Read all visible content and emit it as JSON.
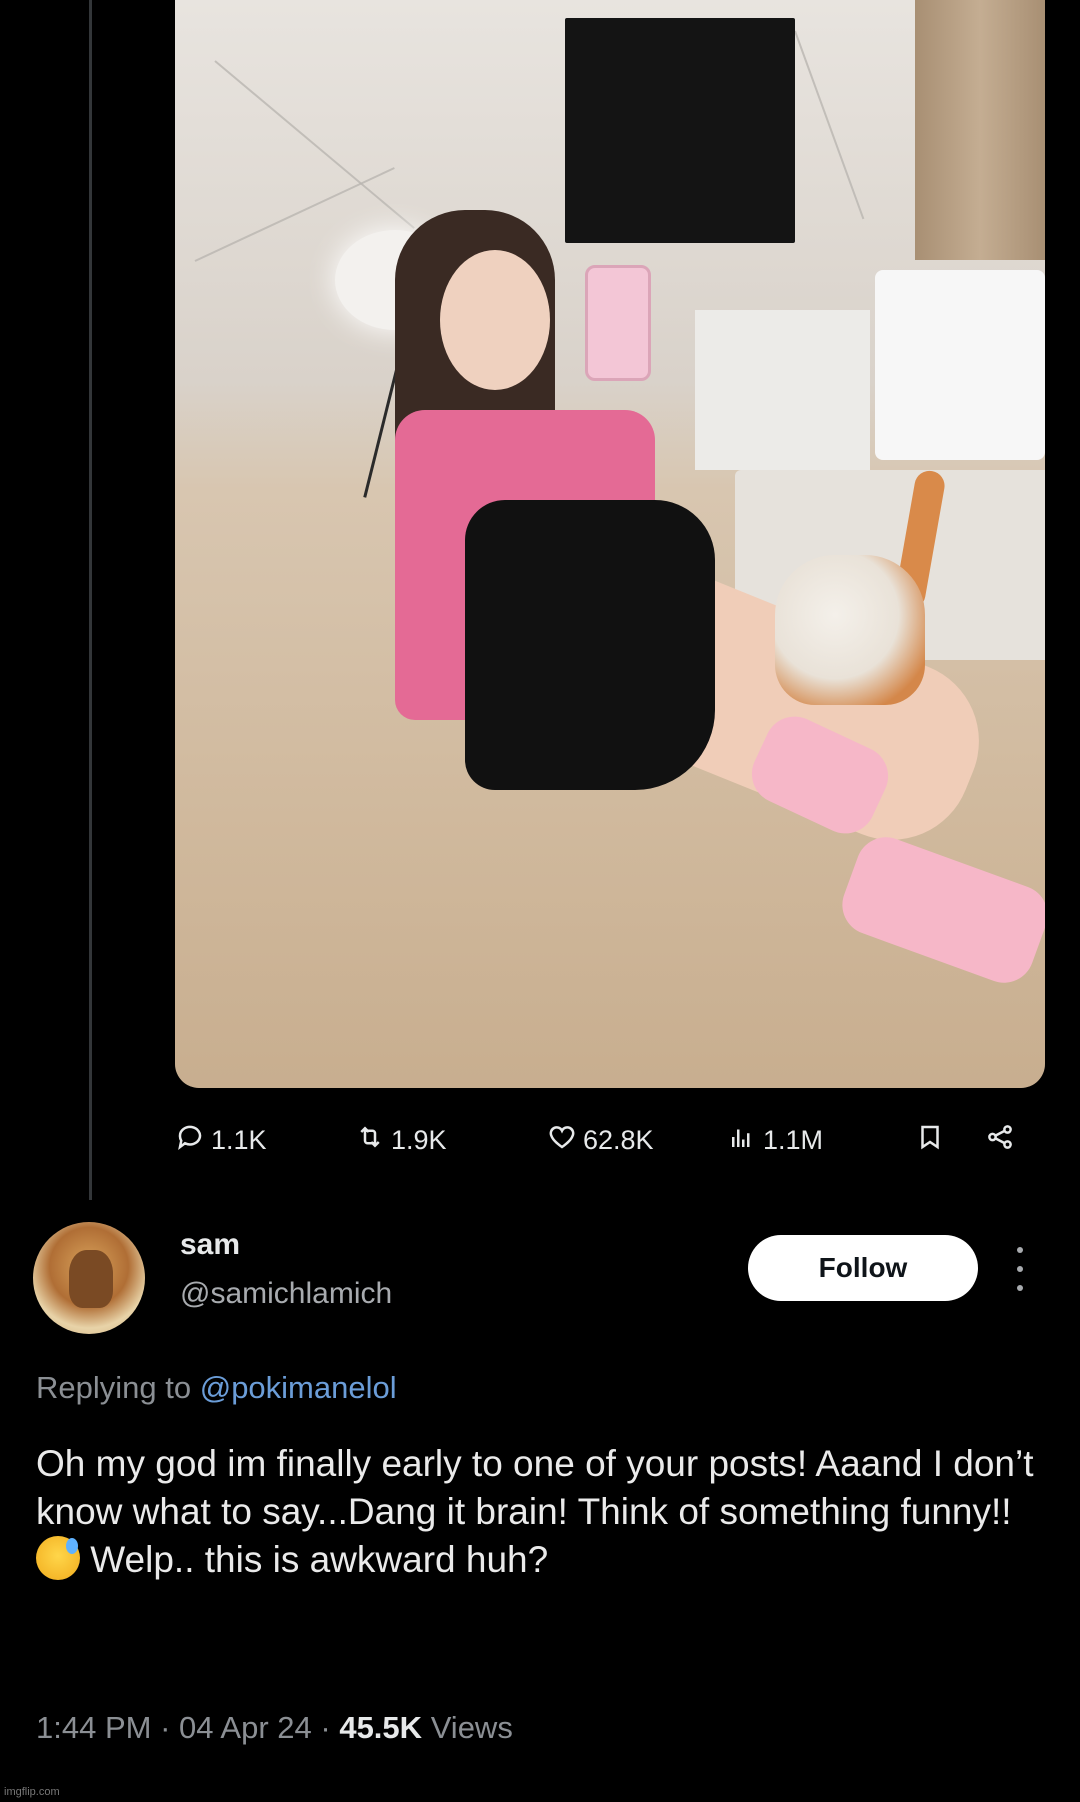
{
  "tweet_actions": {
    "replies": "1.1K",
    "reposts": "1.9K",
    "likes": "62.8K",
    "views": "1.1M"
  },
  "reply": {
    "name": "sam",
    "handle": "@samichlamich",
    "follow_label": "Follow",
    "replying_prefix": "Replying to",
    "replying_to": "@pokimanelol",
    "text_part1": "Oh my god im finally early to one of your posts! Aaand I don’t know what to say...Dang it brain! Think of something funny!!",
    "emoji": "😅",
    "text_part2": " Welp.. this is awkward huh?",
    "time": "1:44 PM",
    "date": "04 Apr 24",
    "views_count": "45.5K",
    "views_label": "Views",
    "separator": "·"
  },
  "watermark": "imgflip.com",
  "icons": {
    "reply": "reply-icon",
    "repost": "repost-icon",
    "like": "heart-icon",
    "views": "analytics-icon",
    "bookmark": "bookmark-icon",
    "share": "share-icon",
    "more": "more-vertical-icon"
  },
  "colors": {
    "background": "#000000",
    "text_primary": "#e7e9ea",
    "text_secondary": "#8b8f94",
    "mention": "#6b9dd8",
    "follow_bg": "#ffffff"
  }
}
